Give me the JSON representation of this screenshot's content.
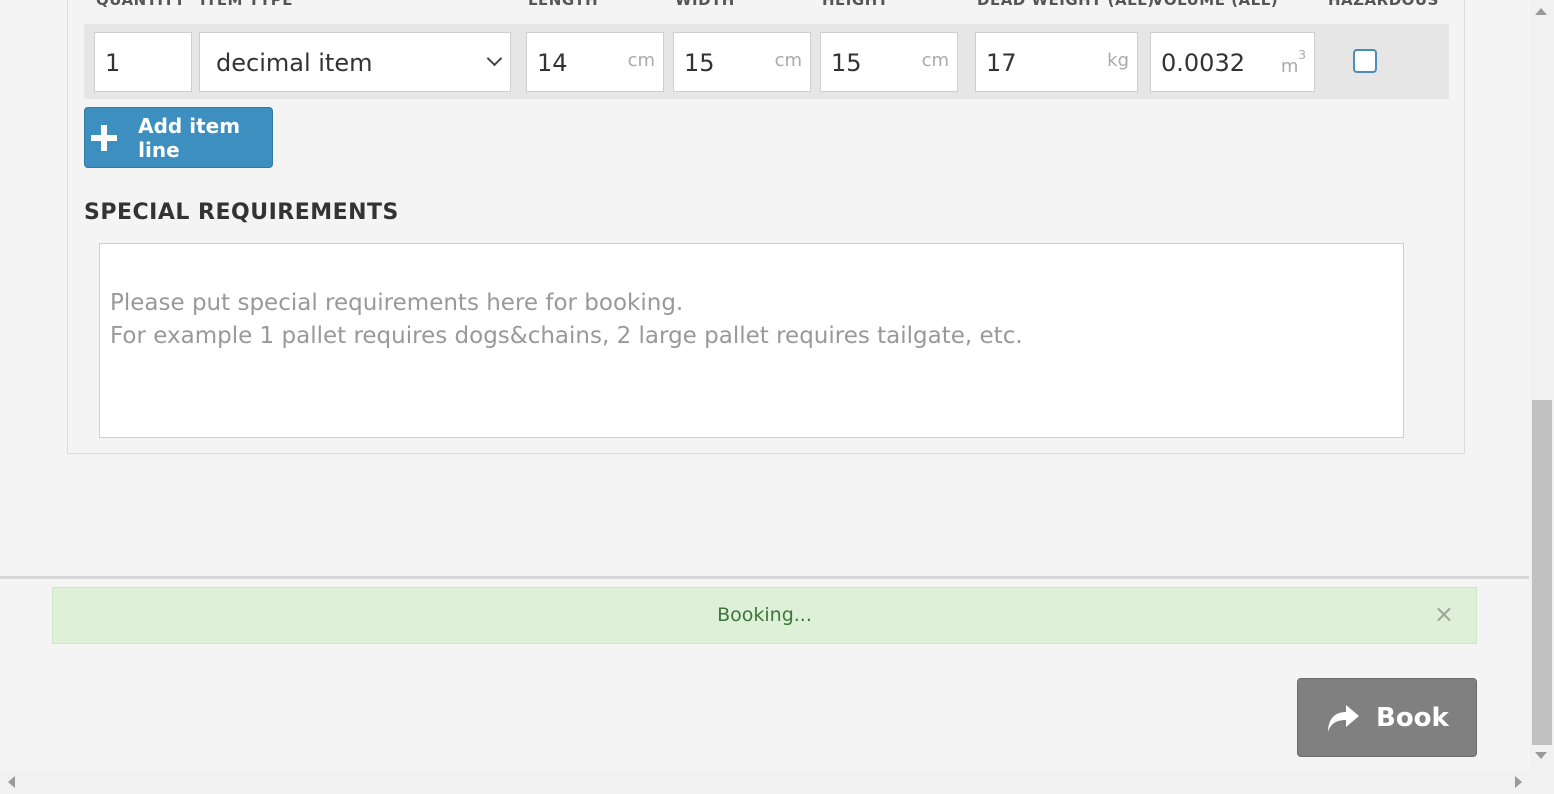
{
  "columns": {
    "quantity": "QUANTITY",
    "item_type": "ITEM TYPE",
    "length": "LENGTH",
    "width": "WIDTH",
    "height": "HEIGHT",
    "dead_weight": "DEAD WEIGHT (ALL)",
    "volume": "VOLUME (ALL)",
    "hazardous": "HAZARDOUS"
  },
  "item_line": {
    "quantity": "1",
    "item_type": "decimal item",
    "length": "14",
    "length_unit": "cm",
    "width": "15",
    "width_unit": "cm",
    "height": "15",
    "height_unit": "cm",
    "dead_weight": "17",
    "dead_weight_unit": "kg",
    "volume": "0.0032",
    "volume_unit": "m",
    "volume_unit_sup": "3",
    "hazardous_checked": false
  },
  "add_item_button": "Add item line",
  "special_requirements": {
    "title": "SPECIAL REQUIREMENTS",
    "placeholder": "Please put special requirements here for booking.\nFor example 1 pallet requires dogs&chains, 2 large pallet requires tailgate, etc."
  },
  "alert": {
    "message": "Booking...",
    "close": "×"
  },
  "book_button": "Book",
  "colors": {
    "primary_button": "#3d8fbf",
    "book_button": "#808080",
    "alert_bg": "#dff0d8",
    "alert_text": "#3c763d"
  }
}
